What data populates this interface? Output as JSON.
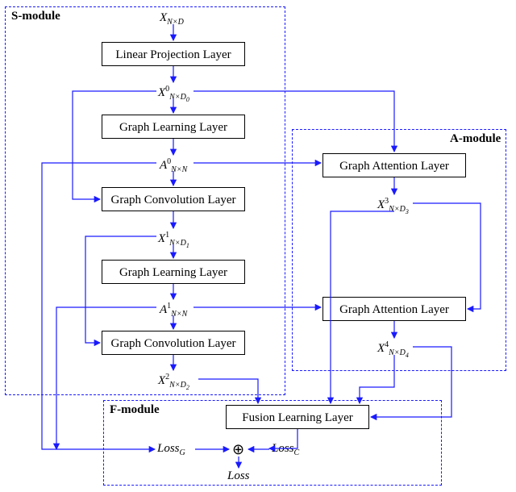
{
  "modules": {
    "s": "S-module",
    "a": "A-module",
    "f": "F-module"
  },
  "blocks": {
    "linproj": "Linear Projection Layer",
    "gl0": "Graph Learning Layer",
    "gc0": "Graph Convolution Layer",
    "gl1": "Graph Learning Layer",
    "gc1": "Graph Convolution Layer",
    "ga0": "Graph Attention Layer",
    "ga1": "Graph Attention Layer",
    "fusion": "Fusion Learning Layer"
  },
  "vars": {
    "X_in": {
      "base": "X",
      "sub": "N×D",
      "sup": ""
    },
    "X0": {
      "base": "X",
      "sub": "N×D",
      "sup": "0",
      "subsub": "0"
    },
    "A0": {
      "base": "A",
      "sub": "N×N",
      "sup": "0"
    },
    "X1": {
      "base": "X",
      "sub": "N×D",
      "sup": "1",
      "subsub": "1"
    },
    "A1": {
      "base": "A",
      "sub": "N×N",
      "sup": "1"
    },
    "X2": {
      "base": "X",
      "sub": "N×D",
      "sup": "2",
      "subsub": "2"
    },
    "X3": {
      "base": "X",
      "sub": "N×D",
      "sup": "3",
      "subsub": "3"
    },
    "X4": {
      "base": "X",
      "sub": "N×D",
      "sup": "4",
      "subsub": "4"
    }
  },
  "losses": {
    "lossG": {
      "base": "Loss",
      "sub": "G"
    },
    "lossC": {
      "base": "Loss",
      "sub": "C"
    },
    "loss": {
      "base": "Loss",
      "sub": ""
    }
  },
  "symbols": {
    "oplus": "⊕"
  },
  "chart_data": {
    "type": "diagram",
    "description": "Architecture diagram with three modules (S-module, A-module, F-module)",
    "nodes": [
      {
        "id": "X_in",
        "kind": "variable",
        "label": "X_{N×D}"
      },
      {
        "id": "linproj",
        "kind": "block",
        "label": "Linear Projection Layer",
        "module": "S"
      },
      {
        "id": "X0",
        "kind": "variable",
        "label": "X^{0}_{N×D_0}"
      },
      {
        "id": "gl0",
        "kind": "block",
        "label": "Graph Learning Layer",
        "module": "S"
      },
      {
        "id": "A0",
        "kind": "variable",
        "label": "A^{0}_{N×N}"
      },
      {
        "id": "gc0",
        "kind": "block",
        "label": "Graph Convolution Layer",
        "module": "S"
      },
      {
        "id": "X1",
        "kind": "variable",
        "label": "X^{1}_{N×D_1}"
      },
      {
        "id": "gl1",
        "kind": "block",
        "label": "Graph Learning Layer",
        "module": "S"
      },
      {
        "id": "A1",
        "kind": "variable",
        "label": "A^{1}_{N×N}"
      },
      {
        "id": "gc1",
        "kind": "block",
        "label": "Graph Convolution Layer",
        "module": "S"
      },
      {
        "id": "X2",
        "kind": "variable",
        "label": "X^{2}_{N×D_2}"
      },
      {
        "id": "ga0",
        "kind": "block",
        "label": "Graph Attention Layer",
        "module": "A"
      },
      {
        "id": "X3",
        "kind": "variable",
        "label": "X^{3}_{N×D_3}"
      },
      {
        "id": "ga1",
        "kind": "block",
        "label": "Graph Attention Layer",
        "module": "A"
      },
      {
        "id": "X4",
        "kind": "variable",
        "label": "X^{4}_{N×D_4}"
      },
      {
        "id": "fusion",
        "kind": "block",
        "label": "Fusion Learning Layer",
        "module": "F"
      },
      {
        "id": "lossG",
        "kind": "variable",
        "label": "Loss_G",
        "module": "F"
      },
      {
        "id": "lossC",
        "kind": "variable",
        "label": "Loss_C",
        "module": "F"
      },
      {
        "id": "oplus",
        "kind": "op",
        "label": "⊕",
        "module": "F"
      },
      {
        "id": "loss",
        "kind": "variable",
        "label": "Loss",
        "module": "F"
      }
    ],
    "edges": [
      [
        "X_in",
        "linproj"
      ],
      [
        "linproj",
        "X0"
      ],
      [
        "X0",
        "gl0"
      ],
      [
        "gl0",
        "A0"
      ],
      [
        "A0",
        "gc0"
      ],
      [
        "X0",
        "gc0"
      ],
      [
        "gc0",
        "X1"
      ],
      [
        "X1",
        "gl1"
      ],
      [
        "gl1",
        "A1"
      ],
      [
        "A1",
        "gc1"
      ],
      [
        "X1",
        "gc1"
      ],
      [
        "gc1",
        "X2"
      ],
      [
        "X0",
        "ga0"
      ],
      [
        "A0",
        "ga0"
      ],
      [
        "ga0",
        "X3"
      ],
      [
        "X3",
        "ga1"
      ],
      [
        "A1",
        "ga1"
      ],
      [
        "ga1",
        "X4"
      ],
      [
        "X2",
        "fusion"
      ],
      [
        "X3",
        "fusion"
      ],
      [
        "X4",
        "fusion"
      ],
      [
        "fusion",
        "lossC"
      ],
      [
        "lossC",
        "oplus"
      ],
      [
        "A0",
        "lossG"
      ],
      [
        "A1",
        "lossG"
      ],
      [
        "lossG",
        "oplus"
      ],
      [
        "oplus",
        "loss"
      ]
    ]
  }
}
